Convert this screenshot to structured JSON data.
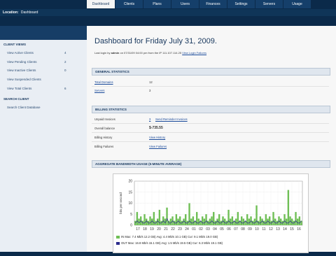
{
  "tabs": [
    {
      "label": "Dashboard",
      "active": true
    },
    {
      "label": "Clients",
      "active": false
    },
    {
      "label": "Plans",
      "active": false
    },
    {
      "label": "Users",
      "active": false
    },
    {
      "label": "Finances",
      "active": false
    },
    {
      "label": "Settings",
      "active": false
    },
    {
      "label": "Servers",
      "active": false
    },
    {
      "label": "Usage",
      "active": false
    }
  ],
  "location": {
    "label": "Location:",
    "value": "Dashboard"
  },
  "sidebar": {
    "client_views_title": "CLIENT VIEWS",
    "items": [
      {
        "label": "View Active Clients",
        "count": "4"
      },
      {
        "label": "View Pending Clients",
        "count": "2"
      },
      {
        "label": "View Inactive Clients",
        "count": "0"
      },
      {
        "label": "View Suspended Clients",
        "count": ""
      },
      {
        "label": "View Total Clients",
        "count": "6"
      }
    ],
    "search_title": "SEARCH CLIENT",
    "search_item": "Search Client Database"
  },
  "header": {
    "title": "Dashboard for Friday July 31, 2009.",
    "last_login_prefix": "Last login by",
    "last_login_user": "admin",
    "last_login_rest": "on 07/31/09 04:00 pm from the IP 111.107.114.25",
    "last_login_link": "View Login Failures"
  },
  "general": {
    "title": "GENERAL STATISTICS",
    "rows": [
      {
        "label": "Total Domains",
        "value": "12"
      },
      {
        "label": "Servers",
        "value": "3"
      }
    ]
  },
  "billing": {
    "title": "BILLING STATISTICS",
    "rows": [
      {
        "label": "Unpaid Invoices",
        "value": "3",
        "link": "Send Reminder Invoices"
      },
      {
        "label": "Overall balance",
        "value": "$-735.55"
      },
      {
        "label": "Billing History",
        "value": "View History"
      },
      {
        "label": "Billing Failures",
        "value": "View Failures"
      }
    ]
  },
  "bandwidth": {
    "title": "AGGREGATE BANDWIDTH USAGE (5-MINUTE AVERAGE)"
  },
  "chart_data": {
    "type": "area",
    "title": "",
    "xlabel": "",
    "ylabel": "bits per second",
    "ylim": [
      0,
      20
    ],
    "y_ticks": [
      "0",
      "5",
      "10",
      "15",
      "20"
    ],
    "x_ticks": [
      "17",
      "18",
      "19",
      "20",
      "21",
      "22",
      "23",
      "24",
      "01",
      "02",
      "03",
      "04",
      "05",
      "06",
      "07",
      "08",
      "09",
      "10",
      "11",
      "12",
      "13",
      "14",
      "15",
      "16"
    ],
    "series": [
      {
        "name": "IN",
        "color": "#6fbf56",
        "values": [
          2,
          6,
          3,
          4,
          2,
          5,
          3,
          2,
          4,
          3,
          6,
          2,
          3,
          7,
          2,
          4,
          3,
          8,
          2,
          3,
          4,
          2,
          5,
          3,
          4,
          2,
          3,
          5,
          2,
          10,
          3,
          4,
          2,
          6,
          3,
          2,
          4,
          3,
          5,
          2,
          3,
          4,
          6,
          2,
          3,
          5,
          2,
          4,
          3,
          2,
          7,
          3,
          4,
          2,
          3,
          6,
          2,
          4,
          3,
          2,
          5,
          3,
          4,
          2,
          3,
          9,
          2,
          4,
          3,
          2,
          5,
          3,
          4,
          2,
          6,
          3,
          2,
          4,
          3,
          2,
          5,
          3,
          16,
          4,
          3,
          2,
          6,
          3,
          4,
          2
        ]
      },
      {
        "name": "OUT",
        "color": "#2c2c8c",
        "values": [
          1,
          2,
          1,
          2,
          1,
          1,
          2,
          1,
          1,
          2,
          1,
          1,
          2,
          1,
          1,
          2,
          1,
          3,
          1,
          1,
          2,
          1,
          1,
          2,
          1,
          1,
          2,
          1,
          1,
          2,
          1,
          1,
          2,
          1,
          1,
          2,
          1,
          1,
          2,
          1,
          1,
          2,
          1,
          1,
          2,
          1,
          1,
          2,
          1,
          1,
          2,
          1,
          1,
          2,
          1,
          1,
          2,
          1,
          1,
          2,
          1,
          1,
          2,
          1,
          1,
          2,
          1,
          1,
          2,
          1,
          1,
          2,
          1,
          1,
          2,
          1,
          1,
          2,
          1,
          1,
          2,
          1,
          1,
          2,
          1,
          1,
          2,
          1,
          1,
          2
        ]
      }
    ],
    "legend": {
      "in_text": "IN   Max: 7.4 Mb/s 12.2 GB)  Avg: 4.4 Mb/s 10.1 GB)  Cur: 9.1 Mb/s 19.0 GB)",
      "out_text": "OUT  Max: 16.8 Mb/s 15.1 GB)  Avg: 1.5 Mb/s 19.5 GB)  Cur: 6.3 Mb/s 19.1 GB)"
    }
  }
}
